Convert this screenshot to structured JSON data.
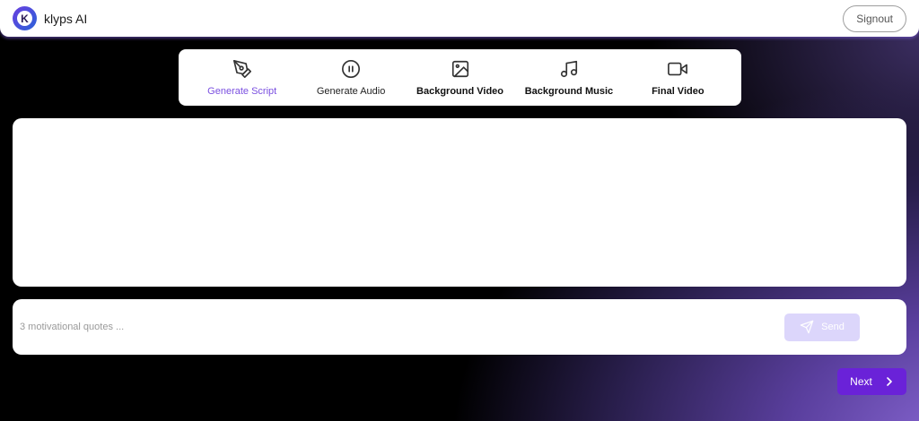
{
  "header": {
    "logo_letter": "K",
    "app_title": "klyps AI",
    "signout_label": "Signout"
  },
  "steps": [
    {
      "label": "Generate Script",
      "icon": "pen-tool-icon",
      "state": "active"
    },
    {
      "label": "Generate Audio",
      "icon": "pause-circle-icon",
      "state": "normal"
    },
    {
      "label": "Background Video",
      "icon": "image-icon",
      "state": "bold"
    },
    {
      "label": "Background Music",
      "icon": "music-note-icon",
      "state": "bold"
    },
    {
      "label": "Final Video",
      "icon": "video-camera-icon",
      "state": "bold"
    }
  ],
  "output": {
    "text": ""
  },
  "prompt": {
    "value": "",
    "placeholder": "3 motivational quotes ...",
    "send_label": "Send"
  },
  "footer": {
    "next_label": "Next"
  },
  "colors": {
    "accent": "#6a22d8",
    "active_step": "#7a4fe0",
    "send_disabled": "#dcd6fb",
    "gradient_purple": "#8b6ad6"
  }
}
